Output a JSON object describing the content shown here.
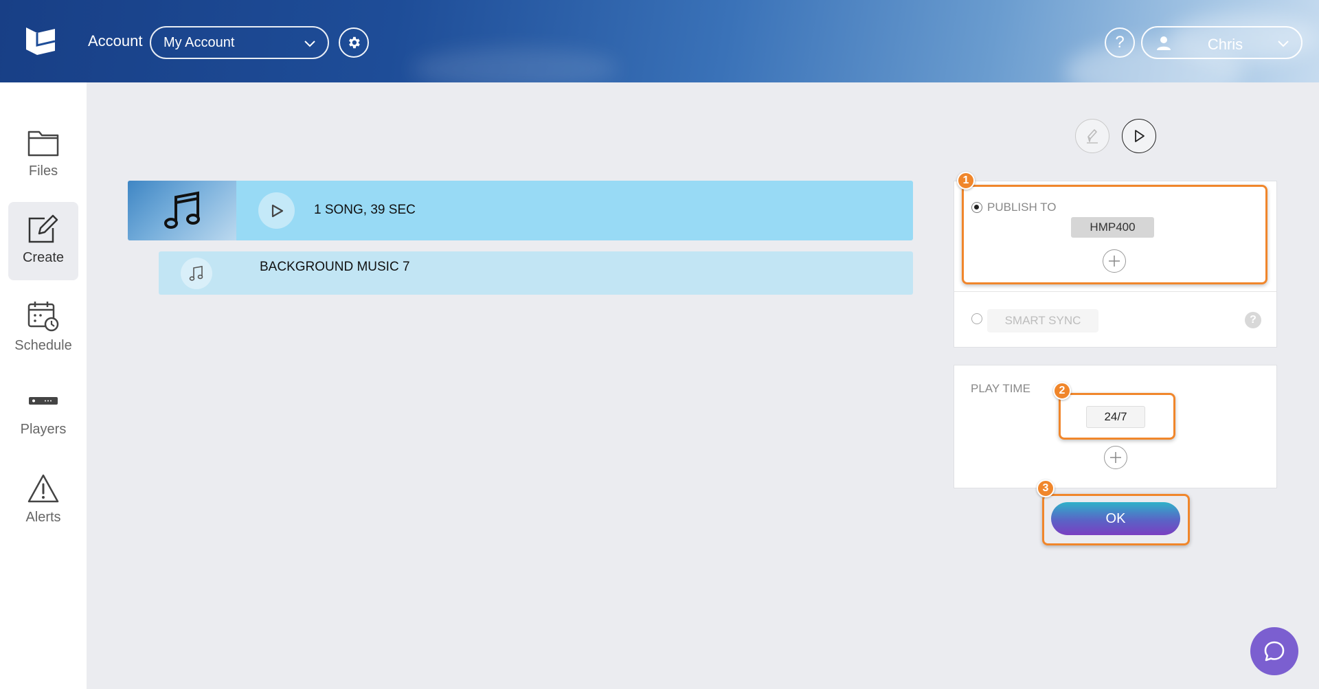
{
  "header": {
    "account_label": "Account",
    "account_select_value": "My Account",
    "help_symbol": "?",
    "user_name": "Chris",
    "icons": [
      "app-logo-icon",
      "chevron-down-icon",
      "gear-icon",
      "user-icon"
    ]
  },
  "sidebar": {
    "items": [
      {
        "label": "Files",
        "icon": "folder-icon",
        "active": false
      },
      {
        "label": "Create",
        "icon": "edit-icon",
        "active": true
      },
      {
        "label": "Schedule",
        "icon": "calendar-clock-icon",
        "active": false
      },
      {
        "label": "Players",
        "icon": "player-device-icon",
        "active": false
      },
      {
        "label": "Alerts",
        "icon": "warning-icon",
        "active": false
      }
    ]
  },
  "playlist": {
    "summary": "1 SONG, 39 SEC",
    "items": [
      {
        "title": "BACKGROUND MUSIC 7",
        "icon": "music-note-icon"
      }
    ]
  },
  "publish": {
    "publish_to_label": "PUBLISH TO",
    "target_player": "HMP400",
    "smart_sync_label": "SMART SYNC",
    "help_symbol": "?"
  },
  "play_time": {
    "label": "PLAY TIME",
    "value": "24/7"
  },
  "actions": {
    "ok_label": "OK"
  },
  "annotations": {
    "step_1": "1",
    "step_2": "2",
    "step_3": "3",
    "color": "#f0862b"
  },
  "colors": {
    "song_row": "#98daf5",
    "sub_row": "#c2e5f4",
    "background": "#ebecf0",
    "chat_button": "#7b5fd0"
  }
}
